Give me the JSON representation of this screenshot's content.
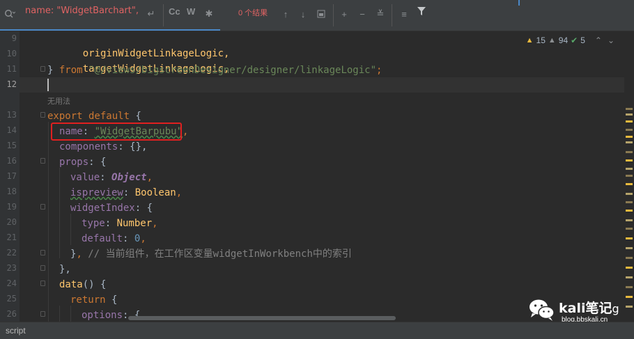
{
  "search": {
    "query": "name: \"WidgetBarchart\",",
    "match_case_label": "Cc",
    "words_label": "W",
    "results": "0 个结果"
  },
  "editor": {
    "current_line": 12,
    "hint_text": "无用法",
    "inspections": {
      "warnings": "15",
      "weak_warnings": "94",
      "typos": "5"
    },
    "lines": [
      {
        "num": "9"
      },
      {
        "num": "10"
      },
      {
        "num": "11"
      },
      {
        "num": "12"
      },
      {
        "num": "13"
      },
      {
        "num": "14"
      },
      {
        "num": "15"
      },
      {
        "num": "16"
      },
      {
        "num": "17"
      },
      {
        "num": "18"
      },
      {
        "num": "19"
      },
      {
        "num": "20"
      },
      {
        "num": "21"
      },
      {
        "num": "22"
      },
      {
        "num": "23"
      },
      {
        "num": "24"
      },
      {
        "num": "25"
      },
      {
        "num": "26"
      }
    ],
    "code": {
      "l9": "originWidgetLinkageLogic,",
      "l10": "targetWidgetLinkageLogic,",
      "l11_brace": "} ",
      "l11_from": "from ",
      "l11_path": "\"@/views/bigscreenDesigner/designer/linkageLogic\"",
      "l11_semi": ";",
      "l13_kw": "export default ",
      "l13_brace": "{",
      "l14_key": "name",
      "l14_colon": ": ",
      "l14_val": "\"WidgetBarpubu\"",
      "l14_comma": ",",
      "l15_key": "components",
      "l15_rest": ": {},",
      "l16_key": "props",
      "l16_rest": ": {",
      "l17_key": "value",
      "l17_colon": ": ",
      "l17_val": "Object",
      "l17_comma": ",",
      "l18_key": "ispreview",
      "l18_colon": ": ",
      "l18_val": "Boolean",
      "l18_comma": ",",
      "l19_key": "widgetIndex",
      "l19_rest": ": {",
      "l20_key": "type",
      "l20_colon": ": ",
      "l20_val": "Number",
      "l20_comma": ",",
      "l21_key": "default",
      "l21_colon": ": ",
      "l21_val": "0",
      "l21_comma": ",",
      "l22_brace": "}",
      "l22_comma": ", ",
      "l22_comment": "// 当前组件，在工作区变量widgetInWorkbench中的索引",
      "l23": "},",
      "l24_fn": "data",
      "l24_rest": "() {",
      "l25_kw": "return ",
      "l25_brace": "{",
      "l26_key": "options",
      "l26_rest": ": {"
    }
  },
  "status": {
    "language": "script"
  },
  "watermark": {
    "title": "kali笔记",
    "url": "blog.bbskali.cn",
    "title_tail": "g"
  },
  "colors": {
    "keyword": "#cc7832",
    "string": "#6a8759",
    "property": "#9876aa",
    "number": "#6897bb",
    "function": "#ffc66d",
    "highlight_box": "#e02020",
    "search_text": "#e06363"
  }
}
